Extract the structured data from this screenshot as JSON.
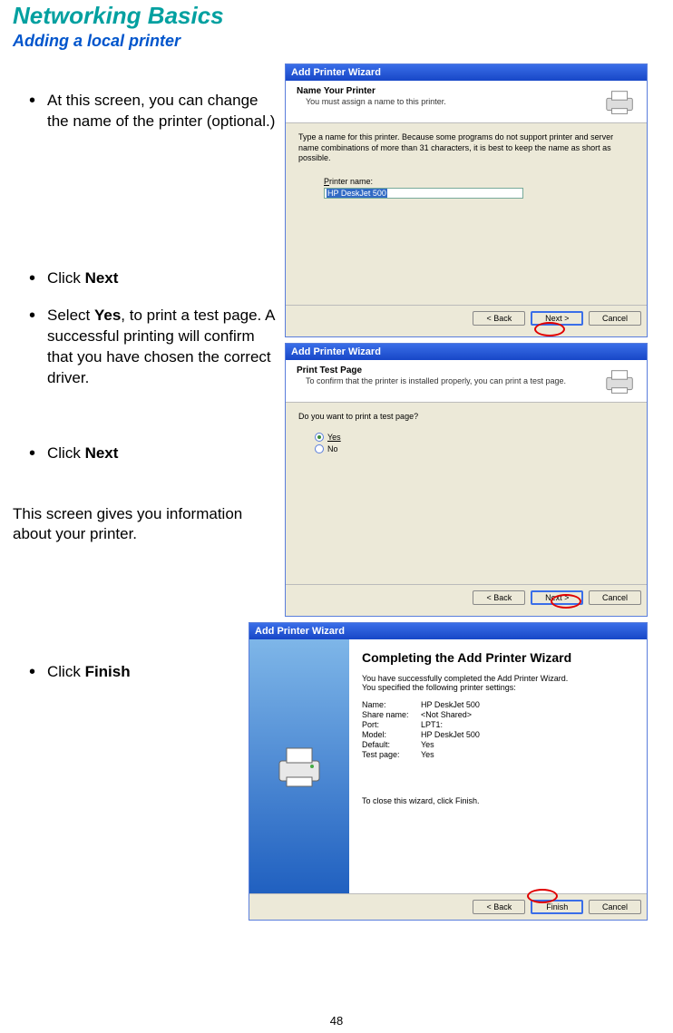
{
  "title": "Networking Basics",
  "subtitle": "Adding a local printer",
  "page_number": "48",
  "left": {
    "step1": "At this screen, you can change the name of the printer (optional.)",
    "step2_a": "Click ",
    "step2_b": "Next",
    "step3_a": "Select  ",
    "step3_b": "Yes",
    "step3_c": ", to print a test page.  A successful printing will confirm that you have chosen the correct driver.",
    "step4_a": "Click ",
    "step4_b": "Next",
    "step5": "This screen gives you information about your printer.",
    "step6_a": "Click ",
    "step6_b": "Finish"
  },
  "wizard1": {
    "window_title": "Add Printer Wizard",
    "header_title": "Name Your Printer",
    "header_sub": "You must assign a name to this printer.",
    "body_text": "Type a name for this printer. Because some programs do not support printer and server name combinations of more than 31 characters, it is best to keep the name as short as possible.",
    "label_printer_name": "Printer name:",
    "printer_name_value": "HP DeskJet 500",
    "btn_back": "< Back",
    "btn_next": "Next >",
    "btn_cancel": "Cancel"
  },
  "wizard2": {
    "window_title": "Add Printer Wizard",
    "header_title": "Print Test Page",
    "header_sub": "To confirm that the printer is installed properly, you can print a test page.",
    "body_text": "Do you want to print a test page?",
    "opt_yes": "Yes",
    "opt_no": "No",
    "btn_back": "< Back",
    "btn_next": "Next >",
    "btn_cancel": "Cancel"
  },
  "wizard3": {
    "window_title": "Add Printer Wizard",
    "final_title": "Completing the Add Printer Wizard",
    "final_body1": "You have successfully completed the Add Printer Wizard.",
    "final_body2": "You specified the following printer settings:",
    "settings": {
      "name_k": "Name:",
      "name_v": "HP DeskJet 500",
      "share_k": "Share name:",
      "share_v": "<Not Shared>",
      "port_k": "Port:",
      "port_v": "LPT1:",
      "model_k": "Model:",
      "model_v": "HP DeskJet 500",
      "default_k": "Default:",
      "default_v": "Yes",
      "test_k": "Test page:",
      "test_v": "Yes"
    },
    "close_text": "To close this wizard, click Finish.",
    "btn_back": "< Back",
    "btn_finish": "Finish",
    "btn_cancel": "Cancel"
  }
}
